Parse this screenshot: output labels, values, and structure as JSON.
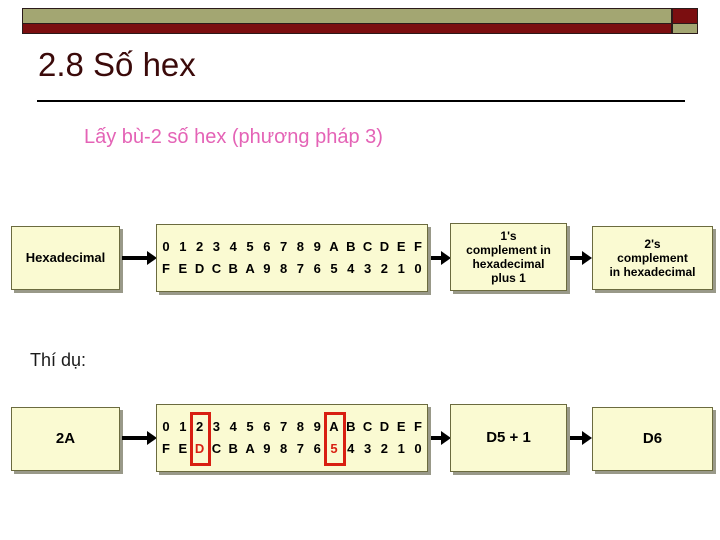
{
  "slide": {
    "title": "2.8 Số hex",
    "subtitle": "Lấy bù-2 số hex (phương pháp 3)",
    "example_label": "Thí dụ:"
  },
  "colors": {
    "title_text": "#3b0a0a",
    "subtitle_text": "#e463b6",
    "box_fill": "#fafad2",
    "box_border": "#6b6b3f",
    "bar_olive": "#a3a672",
    "bar_maroon": "#7b0e10",
    "highlight_red": "#d81f12"
  },
  "row1": {
    "source_box": {
      "label": "Hexadecimal"
    },
    "hex_table": {
      "top": [
        "0",
        "1",
        "2",
        "3",
        "4",
        "5",
        "6",
        "7",
        "8",
        "9",
        "A",
        "B",
        "C",
        "D",
        "E",
        "F"
      ],
      "bottom": [
        "F",
        "E",
        "D",
        "C",
        "B",
        "A",
        "9",
        "8",
        "7",
        "6",
        "5",
        "4",
        "3",
        "2",
        "1",
        "0"
      ],
      "highlights": []
    },
    "step_box": {
      "label": "1's\ncomplement in\nhexadecimal\nplus 1",
      "lines": [
        "1's",
        "complement in",
        "hexadecimal",
        "plus 1"
      ]
    },
    "result_box": {
      "label": "2's\ncomplement\nin hexadecimal",
      "lines": [
        "2's",
        "complement",
        "in hexadecimal"
      ]
    }
  },
  "row2": {
    "source_box": {
      "label": "2A"
    },
    "hex_table": {
      "top": [
        "0",
        "1",
        "2",
        "3",
        "4",
        "5",
        "6",
        "7",
        "8",
        "9",
        "A",
        "B",
        "C",
        "D",
        "E",
        "F"
      ],
      "bottom": [
        "F",
        "E",
        "D",
        "C",
        "B",
        "A",
        "9",
        "8",
        "7",
        "6",
        "5",
        "4",
        "3",
        "2",
        "1",
        "0"
      ],
      "highlights": [
        {
          "index": 2,
          "top_value": "2",
          "bottom_value": "D"
        },
        {
          "index": 10,
          "top_value": "A",
          "bottom_value": "5"
        }
      ]
    },
    "step_box": {
      "label": "D5 + 1",
      "lines": [
        "D5 + 1"
      ]
    },
    "result_box": {
      "label": "D6",
      "lines": [
        "D6"
      ]
    }
  },
  "icons": {
    "arrow": "arrow-right-icon"
  }
}
